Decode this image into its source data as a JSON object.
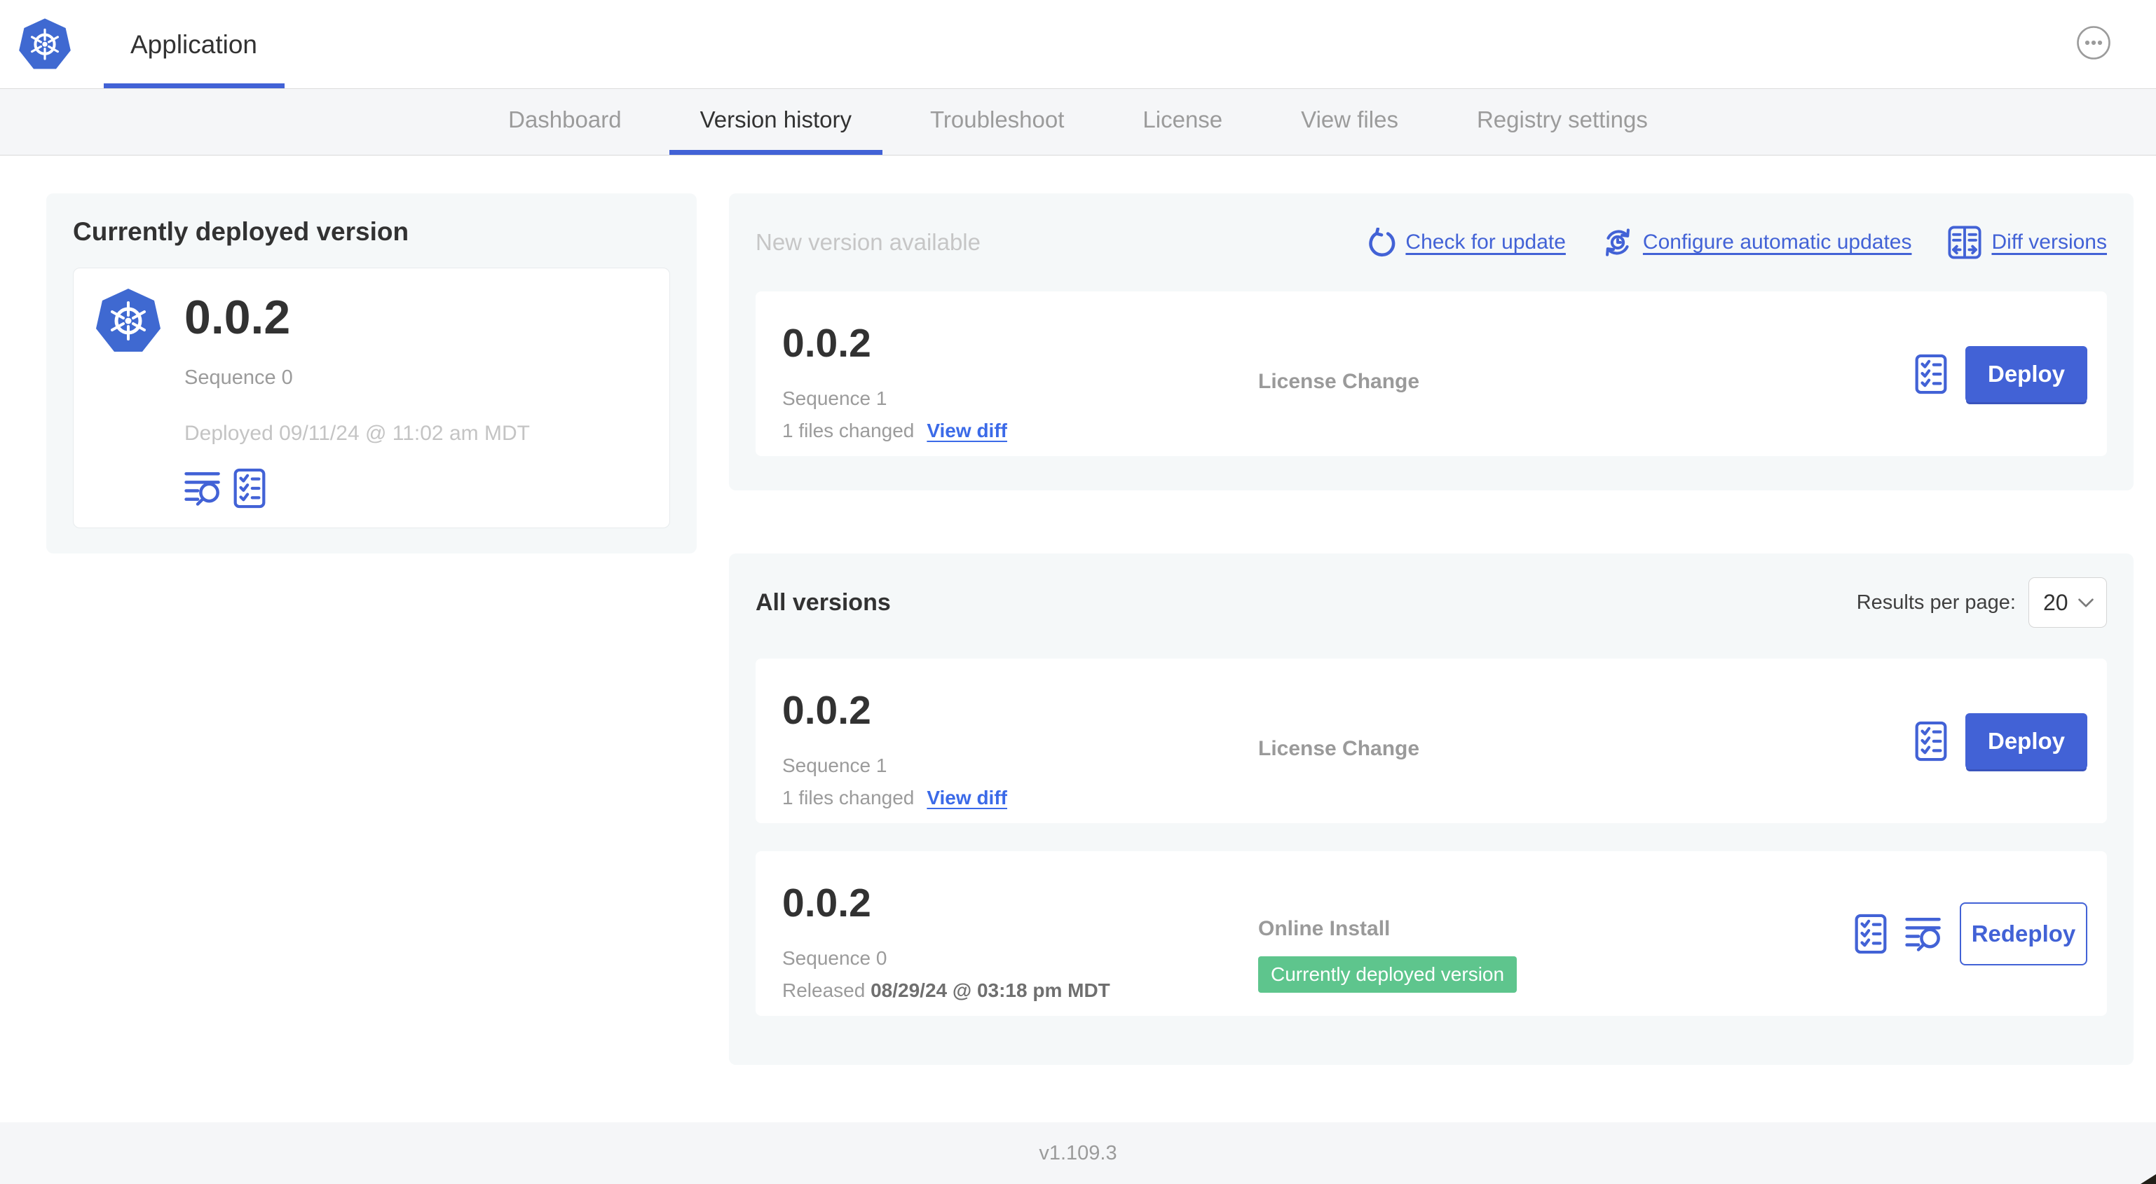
{
  "header": {
    "app_tab_label": "Application"
  },
  "nav": {
    "tabs": [
      {
        "label": "Dashboard",
        "active": false
      },
      {
        "label": "Version history",
        "active": true
      },
      {
        "label": "Troubleshoot",
        "active": false
      },
      {
        "label": "License",
        "active": false
      },
      {
        "label": "View files",
        "active": false
      },
      {
        "label": "Registry settings",
        "active": false
      }
    ]
  },
  "current_version_card": {
    "title": "Currently deployed version",
    "version": "0.0.2",
    "sequence": "Sequence 0",
    "deployed": "Deployed 09/11/24 @ 11:02 am MDT"
  },
  "new_version_card": {
    "title": "New version available",
    "actions": [
      {
        "label": "Check for update",
        "icon": "refresh-icon"
      },
      {
        "label": "Configure automatic updates",
        "icon": "scheduled-update-icon"
      },
      {
        "label": "Diff versions",
        "icon": "diff-icon"
      }
    ],
    "row": {
      "version": "0.0.2",
      "sequence": "Sequence 1",
      "files_changed": "1 files changed",
      "view_diff_label": "View diff",
      "source": "License Change",
      "deploy_label": "Deploy"
    }
  },
  "all_versions_card": {
    "title": "All versions",
    "results_per_page_label": "Results per page:",
    "results_per_page_value": "20",
    "rows": [
      {
        "version": "0.0.2",
        "sequence": "Sequence 1",
        "files_changed": "1 files changed",
        "view_diff_label": "View diff",
        "source": "License Change",
        "deploy_label": "Deploy"
      },
      {
        "version": "0.0.2",
        "sequence": "Sequence 0",
        "released_prefix": "Released",
        "released_date": "08/29/24 @ 03:18 pm MDT",
        "source": "Online Install",
        "badge": "Currently deployed version",
        "redeploy_label": "Redeploy"
      }
    ]
  },
  "footer": {
    "version": "v1.109.3"
  },
  "colors": {
    "accent_blue": "#4262d6",
    "link_blue": "#3b6ae8",
    "logo_blue": "#3f69d1",
    "badge_green": "#5ec58d",
    "subnav_bg": "#f5f6f8",
    "card_bg": "#f5f8f9"
  }
}
